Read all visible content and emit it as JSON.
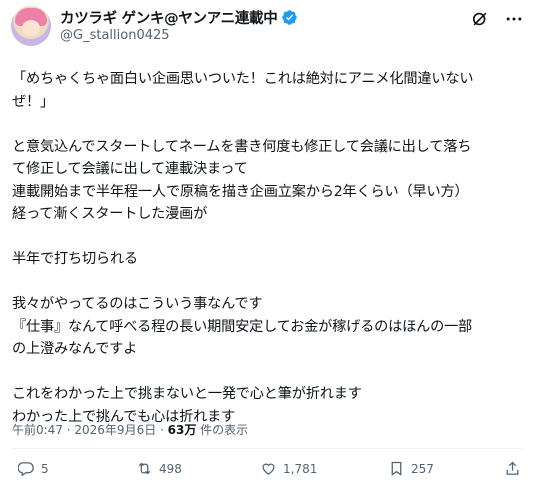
{
  "author": {
    "display_name": "カツラギ ゲンキ@ヤンアニ連載中",
    "handle": "@G_stallion0425",
    "verified_badge_color": "#1d9bf0",
    "avatar_icon": "anime-character-avatar"
  },
  "top_icons": [
    "grok-icon",
    "more-icon"
  ],
  "post": {
    "text": "「めちゃくちゃ面白い企画思いついた！これは絶対にアニメ化間違いない\nぜ！」\n\nと意気込んでスタートしてネームを書き何度も修正して会議に出して落ち\nて修正して会議に出して連載決まって\n連載開始まで半年程一人で原稿を描き企画立案から2年くらい（早い方）\n経って漸くスタートした漫画が\n\n半年で打ち切られる\n\n我々がやってるのはこういう事なんです\n『仕事』なんて呼べる程の長い期間安定してお金が稼げるのはほんの一部\nの上澄みなんですよ\n\nこれをわかった上で挑まないと一発で心と筆が折れます\nわかった上で挑んでも心は折れます"
  },
  "meta": {
    "timestamp": "午前0:47 · 2026年9月6日 · ",
    "views_count": "63万",
    "views_label": " 件の表示"
  },
  "actions": {
    "replies": "5",
    "reposts": "498",
    "likes": "1,781",
    "bookmarks": "257"
  }
}
